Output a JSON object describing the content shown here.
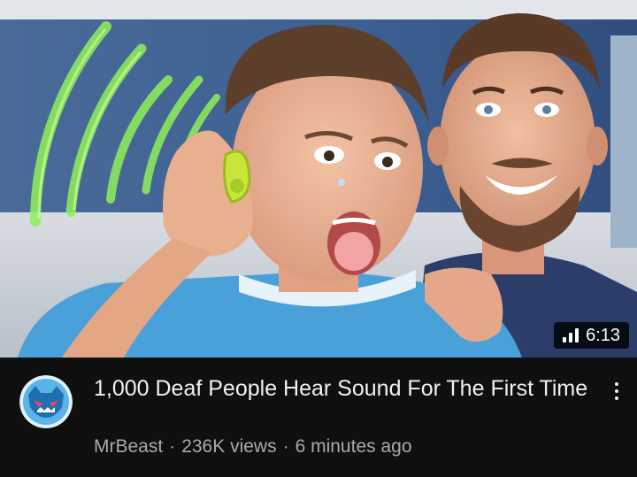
{
  "video": {
    "duration": "6:13",
    "title": "1,000 Deaf People Hear Sound For The First Time",
    "channel": "MrBeast",
    "views": "236K views",
    "uploaded": "6 minutes ago",
    "separator": "·"
  },
  "icons": {
    "duration_badge_icon": "signal-bars-icon",
    "menu": "more-vertical-icon",
    "avatar": "mrbeast-logo"
  },
  "colors": {
    "background": "#0f0f0f",
    "title_text": "#f1f1f1",
    "meta_text": "#aaaaaa",
    "badge_bg": "#000000",
    "avatar_blue": "#5ab4e8"
  }
}
